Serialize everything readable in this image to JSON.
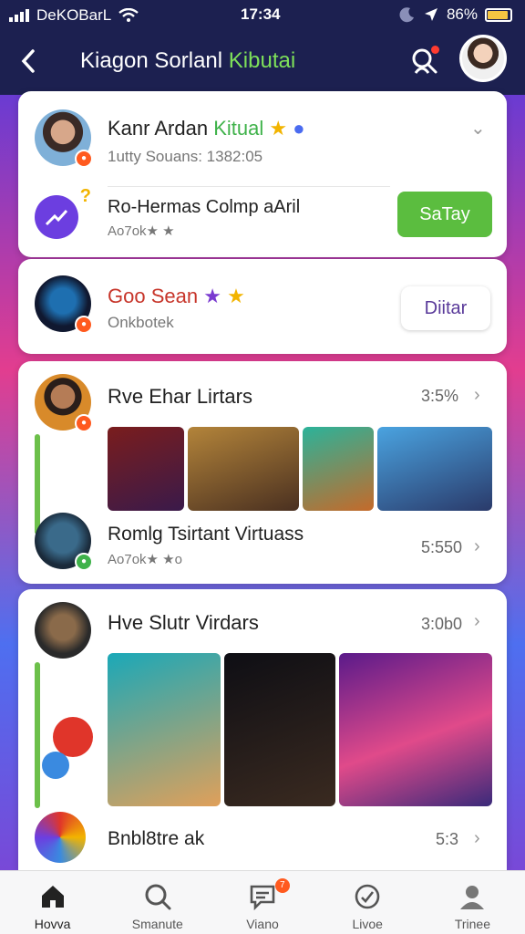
{
  "status": {
    "carrier": "DeKOBarL",
    "time": "17:34",
    "battery": "86%"
  },
  "header": {
    "title_main": "Kiagon Sorlanl",
    "title_accent": "Kibutai"
  },
  "cards": [
    {
      "name": "Kanr Ardan",
      "tag": "Kitual",
      "sub": "1utty Souans: 1382:05",
      "row2_title": "Ro-Hermas Colmp aAril",
      "row2_sub": "Ao7ok★ ★",
      "button": "SaTay"
    },
    {
      "name": "Goo Sean",
      "sub": "Onkbotek",
      "button": "Diitar"
    },
    {
      "name": "Rve Ehar Lirtars",
      "time": "3:5%",
      "row2_title": "Romlg Tsirtant Virtuass",
      "row2_sub": "Ao7ok★ ★o",
      "row2_time": "5:550"
    },
    {
      "name": "Hve Slutr Virdars",
      "time": "3:0b0",
      "row3_title": "Bnbl8tre ak",
      "row3_time": "5:3"
    }
  ],
  "tabs": [
    {
      "label": "Hovva",
      "icon": "home-icon"
    },
    {
      "label": "Smanute",
      "icon": "search-icon"
    },
    {
      "label": "Viano",
      "icon": "chat-icon",
      "badge": "7"
    },
    {
      "label": "Livoe",
      "icon": "clock-icon"
    },
    {
      "label": "Trinee",
      "icon": "person-icon"
    }
  ]
}
